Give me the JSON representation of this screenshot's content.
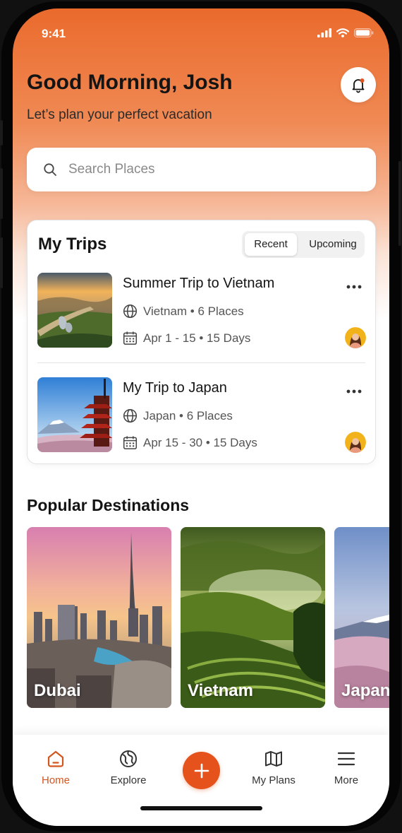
{
  "status": {
    "time": "9:41"
  },
  "header": {
    "greeting": "Good Morning, Josh",
    "subtitle": "Let’s plan your perfect vacation"
  },
  "search": {
    "placeholder": "Search Places",
    "value": ""
  },
  "my_trips": {
    "title": "My Trips",
    "tabs": [
      {
        "label": "Recent",
        "selected": true
      },
      {
        "label": "Upcoming",
        "selected": false
      }
    ],
    "trips": [
      {
        "name": "Summer Trip to Vietnam",
        "places": "Vietnam • 6 Places",
        "dates": "Apr 1 - 15 • 15 Days"
      },
      {
        "name": "My Trip to Japan",
        "places": "Japan • 6 Places",
        "dates": "Apr 15 - 30 • 15 Days"
      }
    ]
  },
  "popular": {
    "title": "Popular Destinations",
    "destinations": [
      {
        "name": "Dubai"
      },
      {
        "name": "Vietnam"
      },
      {
        "name": "Japan"
      }
    ]
  },
  "tabbar": {
    "items": [
      {
        "label": "Home",
        "icon": "home-icon",
        "active": true
      },
      {
        "label": "Explore",
        "icon": "globe-icon",
        "active": false
      },
      {
        "label": "My Plans",
        "icon": "map-icon",
        "active": false
      },
      {
        "label": "More",
        "icon": "menu-icon",
        "active": false
      }
    ],
    "fab_icon": "plus-icon"
  },
  "colors": {
    "accent": "#e5521c",
    "active_tab": "#d4561f",
    "header_gradient_top": "#ea6a2c"
  }
}
